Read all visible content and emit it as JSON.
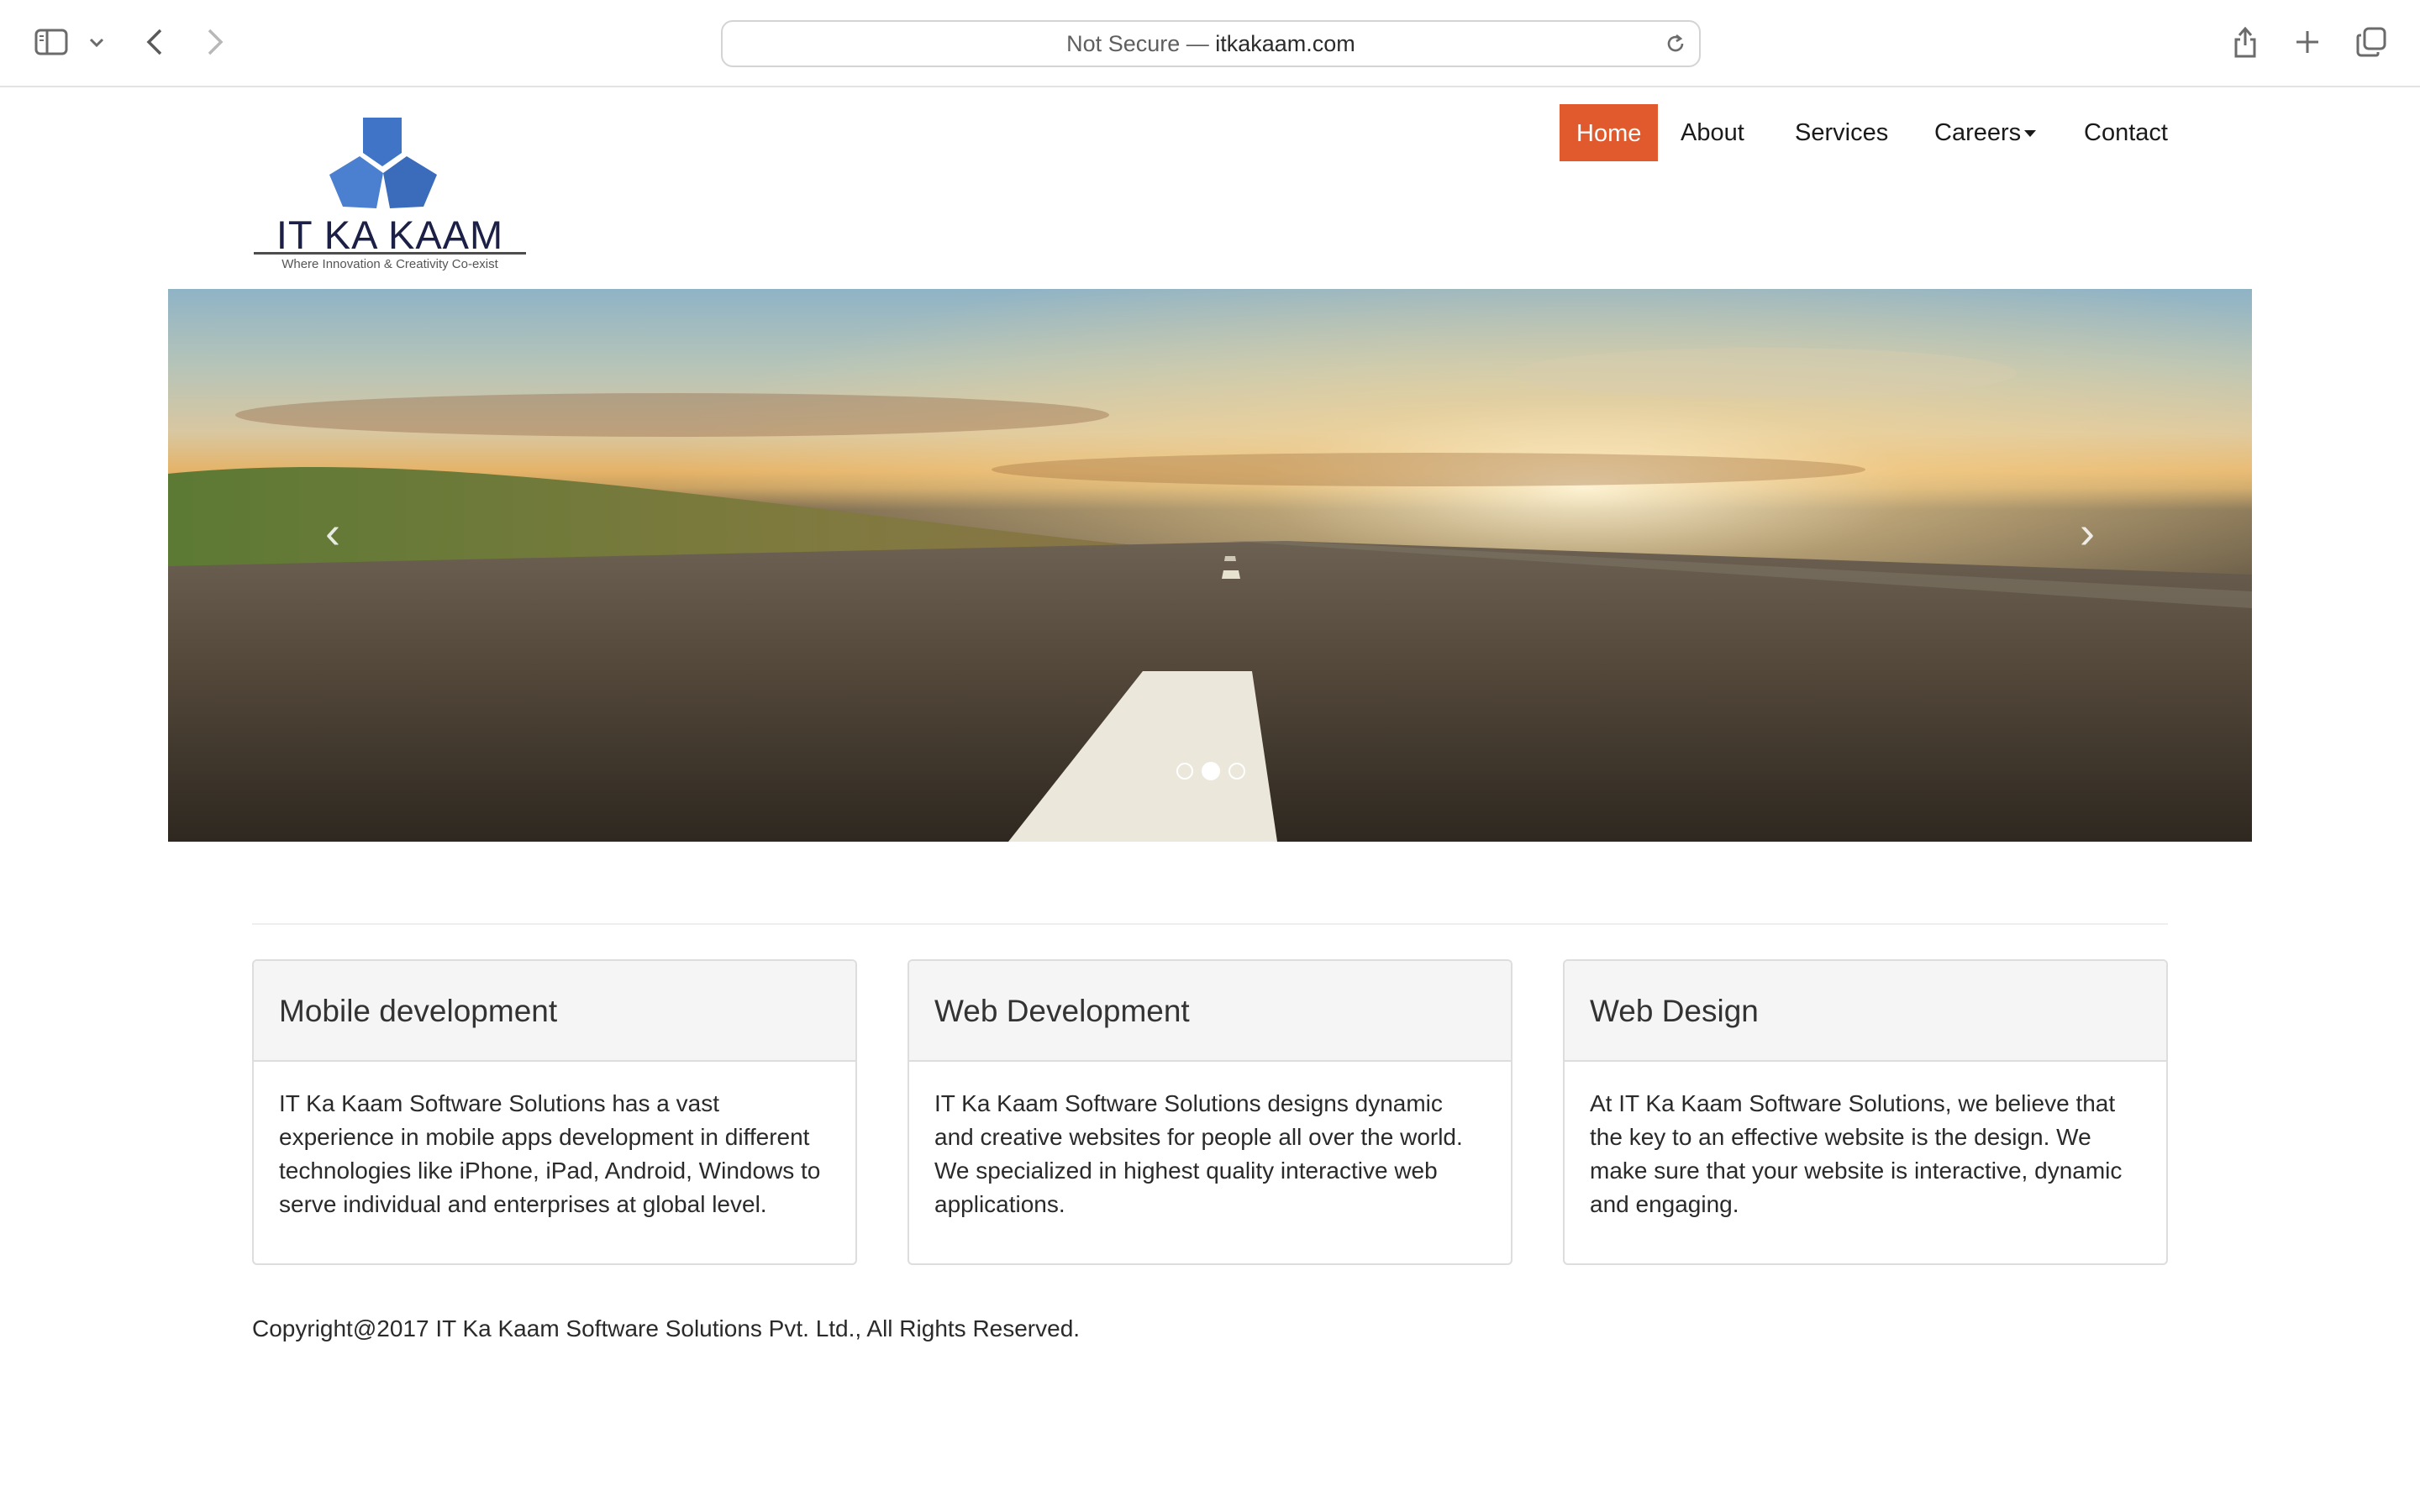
{
  "browser": {
    "address_prefix": "Not Secure — ",
    "address_host": "itkakaam.com"
  },
  "logo": {
    "title": "IT KA KAAM",
    "tagline": "Where Innovation & Creativity Co-exist",
    "color": "#3f74c6"
  },
  "nav": {
    "items": [
      {
        "label": "Home"
      },
      {
        "label": "About"
      },
      {
        "label": "Services"
      },
      {
        "label": "Careers"
      },
      {
        "label": "Contact"
      }
    ],
    "active_color": "#e05a2e"
  },
  "carousel": {
    "prev": "‹",
    "next": "›",
    "slide_count": 3,
    "active_index": 1
  },
  "panels": [
    {
      "title": "Mobile development",
      "body": "IT Ka Kaam Software Solutions has a vast experience in mobile apps development in different technologies like iPhone, iPad, Android, Windows to serve individual and enterprises at global level."
    },
    {
      "title": "Web Development",
      "body": "IT Ka Kaam Software Solutions designs dynamic and creative websites for people all over the world. We specialized in highest quality interactive web applications."
    },
    {
      "title": "Web Design",
      "body": "At IT Ka Kaam Software Solutions, we believe that the key to an effective website is the design. We make sure that your website is interactive, dynamic and engaging."
    }
  ],
  "footer": {
    "copyright": "Copyright@2017 IT Ka Kaam Software Solutions Pvt. Ltd., All Rights Reserved."
  }
}
